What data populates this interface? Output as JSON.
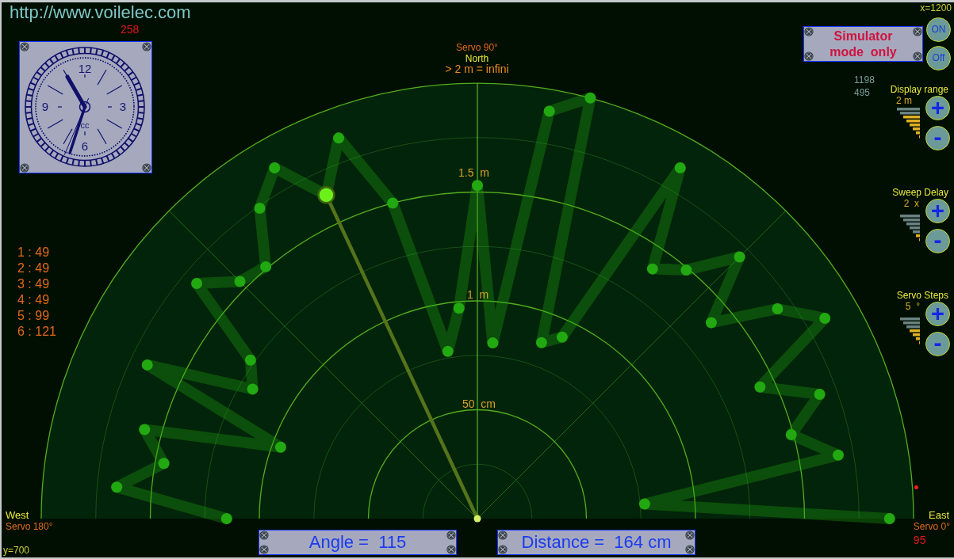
{
  "header": {
    "url": "http://www.voilelec.com",
    "counter": "258"
  },
  "clock": {
    "numerals": [
      "12",
      "3",
      "6",
      "9"
    ],
    "mark": "cc"
  },
  "readings": [
    "1 : 49",
    "2 : 49",
    "3 : 49",
    "4 : 49",
    "5 : 99",
    "6 : 121"
  ],
  "west": {
    "label": "West",
    "servo": "Servo 180°"
  },
  "y_coordinate": "y=700",
  "north": {
    "servo": "Servo 90°",
    "label": "North",
    "note": "> 2 m = infini"
  },
  "radar": {
    "ring_labels": [
      "1.5  m",
      "1  m",
      "50  cm"
    ]
  },
  "readouts": {
    "angle": "Angle =  115",
    "distance": "Distance =  164 cm"
  },
  "x_coordinate": "x=1200",
  "simulator": {
    "lines": [
      "Simulator",
      "mode  only"
    ]
  },
  "power_buttons": [
    {
      "label": "ON"
    },
    {
      "label": "Off"
    }
  ],
  "cursor": [
    "1198",
    "495"
  ],
  "settings": [
    {
      "label": "Display range",
      "value": "2 m",
      "level": 0.75,
      "increase": "+",
      "decrease": "-"
    },
    {
      "label": "Sweep Delay",
      "value": "2  x",
      "level": 0.29,
      "increase": "+",
      "decrease": "-"
    },
    {
      "label": "Servo Steps",
      "value": "5  °",
      "level": 0.57,
      "increase": "+",
      "decrease": "-"
    }
  ],
  "east": {
    "label": "East",
    "servo": "Servo 0°",
    "reading": "95"
  }
}
